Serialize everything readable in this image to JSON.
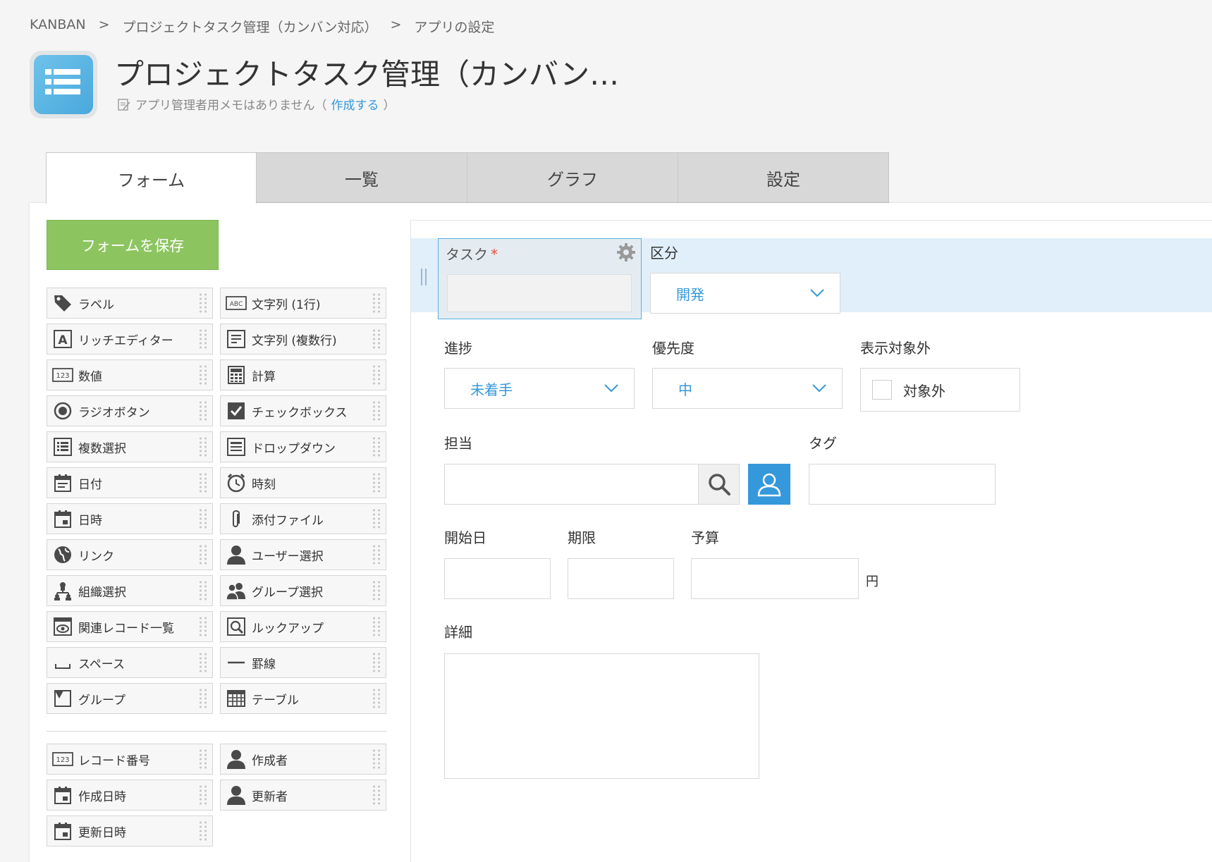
{
  "breadcrumb": {
    "items": [
      "KANBAN",
      "プロジェクトタスク管理（カンバン対応）",
      "アプリの設定"
    ],
    "separator": ">"
  },
  "app": {
    "title": "プロジェクトタスク管理（カンバン…",
    "memo_text": "アプリ管理者用メモはありません（",
    "memo_link": "作成する",
    "memo_close": "）",
    "icon": "list-app-icon"
  },
  "tabs": [
    {
      "label": "フォーム",
      "active": true
    },
    {
      "label": "一覧",
      "active": false
    },
    {
      "label": "グラフ",
      "active": false
    },
    {
      "label": "設定",
      "active": false
    }
  ],
  "save_button": "フォームを保存",
  "palette": {
    "fields": [
      {
        "label": "ラベル",
        "icon": "tag-icon"
      },
      {
        "label": "文字列 (1行)",
        "icon": "abc-icon"
      },
      {
        "label": "リッチエディター",
        "icon": "rich-editor-icon"
      },
      {
        "label": "文字列 (複数行)",
        "icon": "multiline-text-icon"
      },
      {
        "label": "数値",
        "icon": "number-icon"
      },
      {
        "label": "計算",
        "icon": "calculator-icon"
      },
      {
        "label": "ラジオボタン",
        "icon": "radio-icon"
      },
      {
        "label": "チェックボックス",
        "icon": "checkbox-icon"
      },
      {
        "label": "複数選択",
        "icon": "multi-select-icon"
      },
      {
        "label": "ドロップダウン",
        "icon": "dropdown-icon"
      },
      {
        "label": "日付",
        "icon": "date-icon"
      },
      {
        "label": "時刻",
        "icon": "clock-icon"
      },
      {
        "label": "日時",
        "icon": "datetime-icon"
      },
      {
        "label": "添付ファイル",
        "icon": "paperclip-icon"
      },
      {
        "label": "リンク",
        "icon": "globe-icon"
      },
      {
        "label": "ユーザー選択",
        "icon": "user-icon"
      },
      {
        "label": "組織選択",
        "icon": "org-icon"
      },
      {
        "label": "グループ選択",
        "icon": "group-icon"
      },
      {
        "label": "関連レコード一覧",
        "icon": "related-records-icon"
      },
      {
        "label": "ルックアップ",
        "icon": "lookup-icon"
      },
      {
        "label": "スペース",
        "icon": "space-icon"
      },
      {
        "label": "罫線",
        "icon": "line-icon"
      },
      {
        "label": "グループ",
        "icon": "group-folder-icon"
      },
      {
        "label": "テーブル",
        "icon": "table-icon"
      }
    ],
    "system_fields": [
      {
        "label": "レコード番号",
        "icon": "number-icon"
      },
      {
        "label": "作成者",
        "icon": "user-icon"
      },
      {
        "label": "作成日時",
        "icon": "datetime-icon"
      },
      {
        "label": "更新者",
        "icon": "user-icon"
      },
      {
        "label": "更新日時",
        "icon": "datetime-icon"
      }
    ]
  },
  "form": {
    "task": {
      "label": "タスク",
      "required_mark": "*"
    },
    "category": {
      "label": "区分",
      "value": "開発"
    },
    "progress": {
      "label": "進捗",
      "value": "未着手"
    },
    "priority": {
      "label": "優先度",
      "value": "中"
    },
    "exclude": {
      "label": "表示対象外",
      "option": "対象外"
    },
    "assignee": {
      "label": "担当"
    },
    "tag": {
      "label": "タグ"
    },
    "start_date": {
      "label": "開始日"
    },
    "due": {
      "label": "期限"
    },
    "budget": {
      "label": "予算",
      "unit": "円"
    },
    "detail": {
      "label": "詳細"
    }
  },
  "colors": {
    "accent": "#3498db",
    "save": "#8cc55f",
    "highlight": "#e1effa",
    "required": "#e74c3c"
  }
}
